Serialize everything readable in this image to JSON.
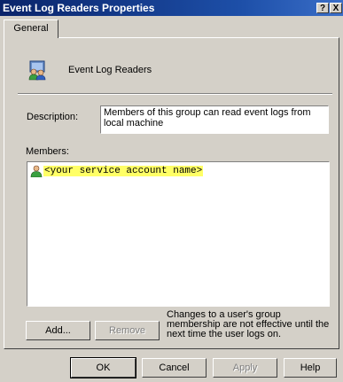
{
  "window": {
    "title": "Event Log Readers Properties",
    "help_btn": "?",
    "close_btn": "X"
  },
  "tabs": [
    {
      "label": "General",
      "selected": true
    }
  ],
  "group": {
    "name": "Event Log Readers",
    "icon": "user-group-icon"
  },
  "description": {
    "label": "Description:",
    "value": "Members of this group can read event logs from local machine"
  },
  "members": {
    "label": "Members:",
    "items": [
      {
        "name": "<your service account name>",
        "icon": "user-icon",
        "highlighted": true
      }
    ]
  },
  "buttons": {
    "add": "Add...",
    "remove": "Remove"
  },
  "note": "Changes to a user's group membership are not effective until the next time the user logs on.",
  "dialog_buttons": {
    "ok": "OK",
    "cancel": "Cancel",
    "apply": "Apply",
    "help": "Help"
  },
  "colors": {
    "title_bar": "#0a246a",
    "face": "#d4d0c8",
    "highlight": "#ffff66"
  }
}
